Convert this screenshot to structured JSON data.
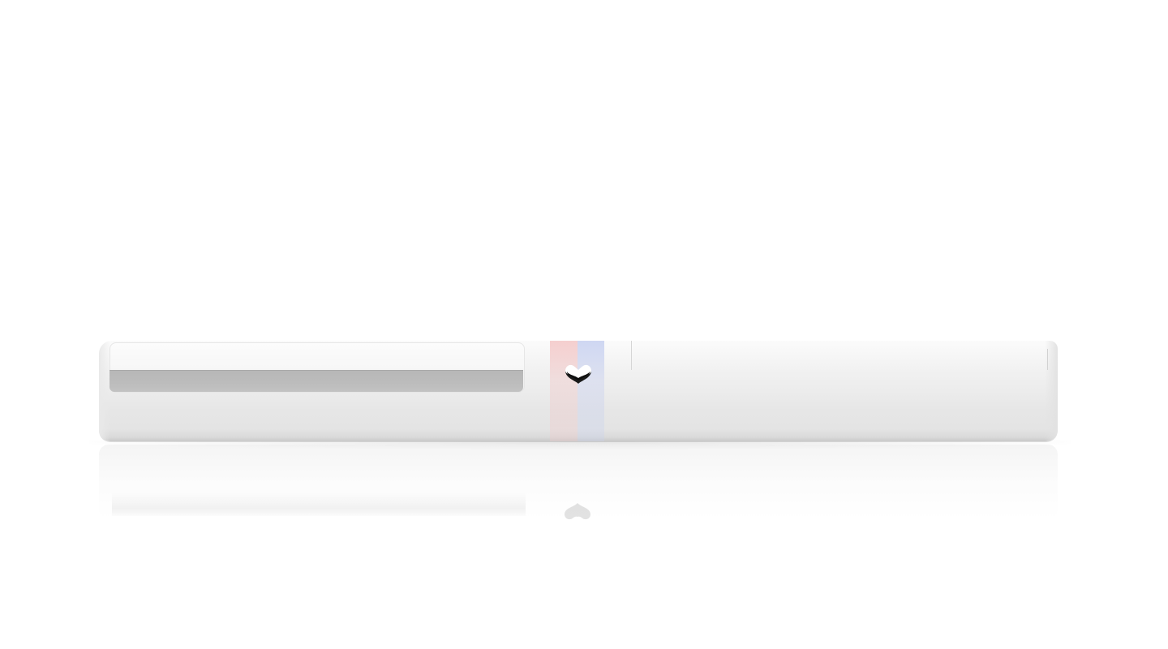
{
  "scene": {
    "product": {
      "emblem_icon": "heart-icon",
      "colors": {
        "body": "#ececec",
        "slot_window": "#bababa",
        "stripe_left": "#f0aaaa",
        "stripe_right": "#aab9eb",
        "emblem": "#111111"
      }
    }
  }
}
